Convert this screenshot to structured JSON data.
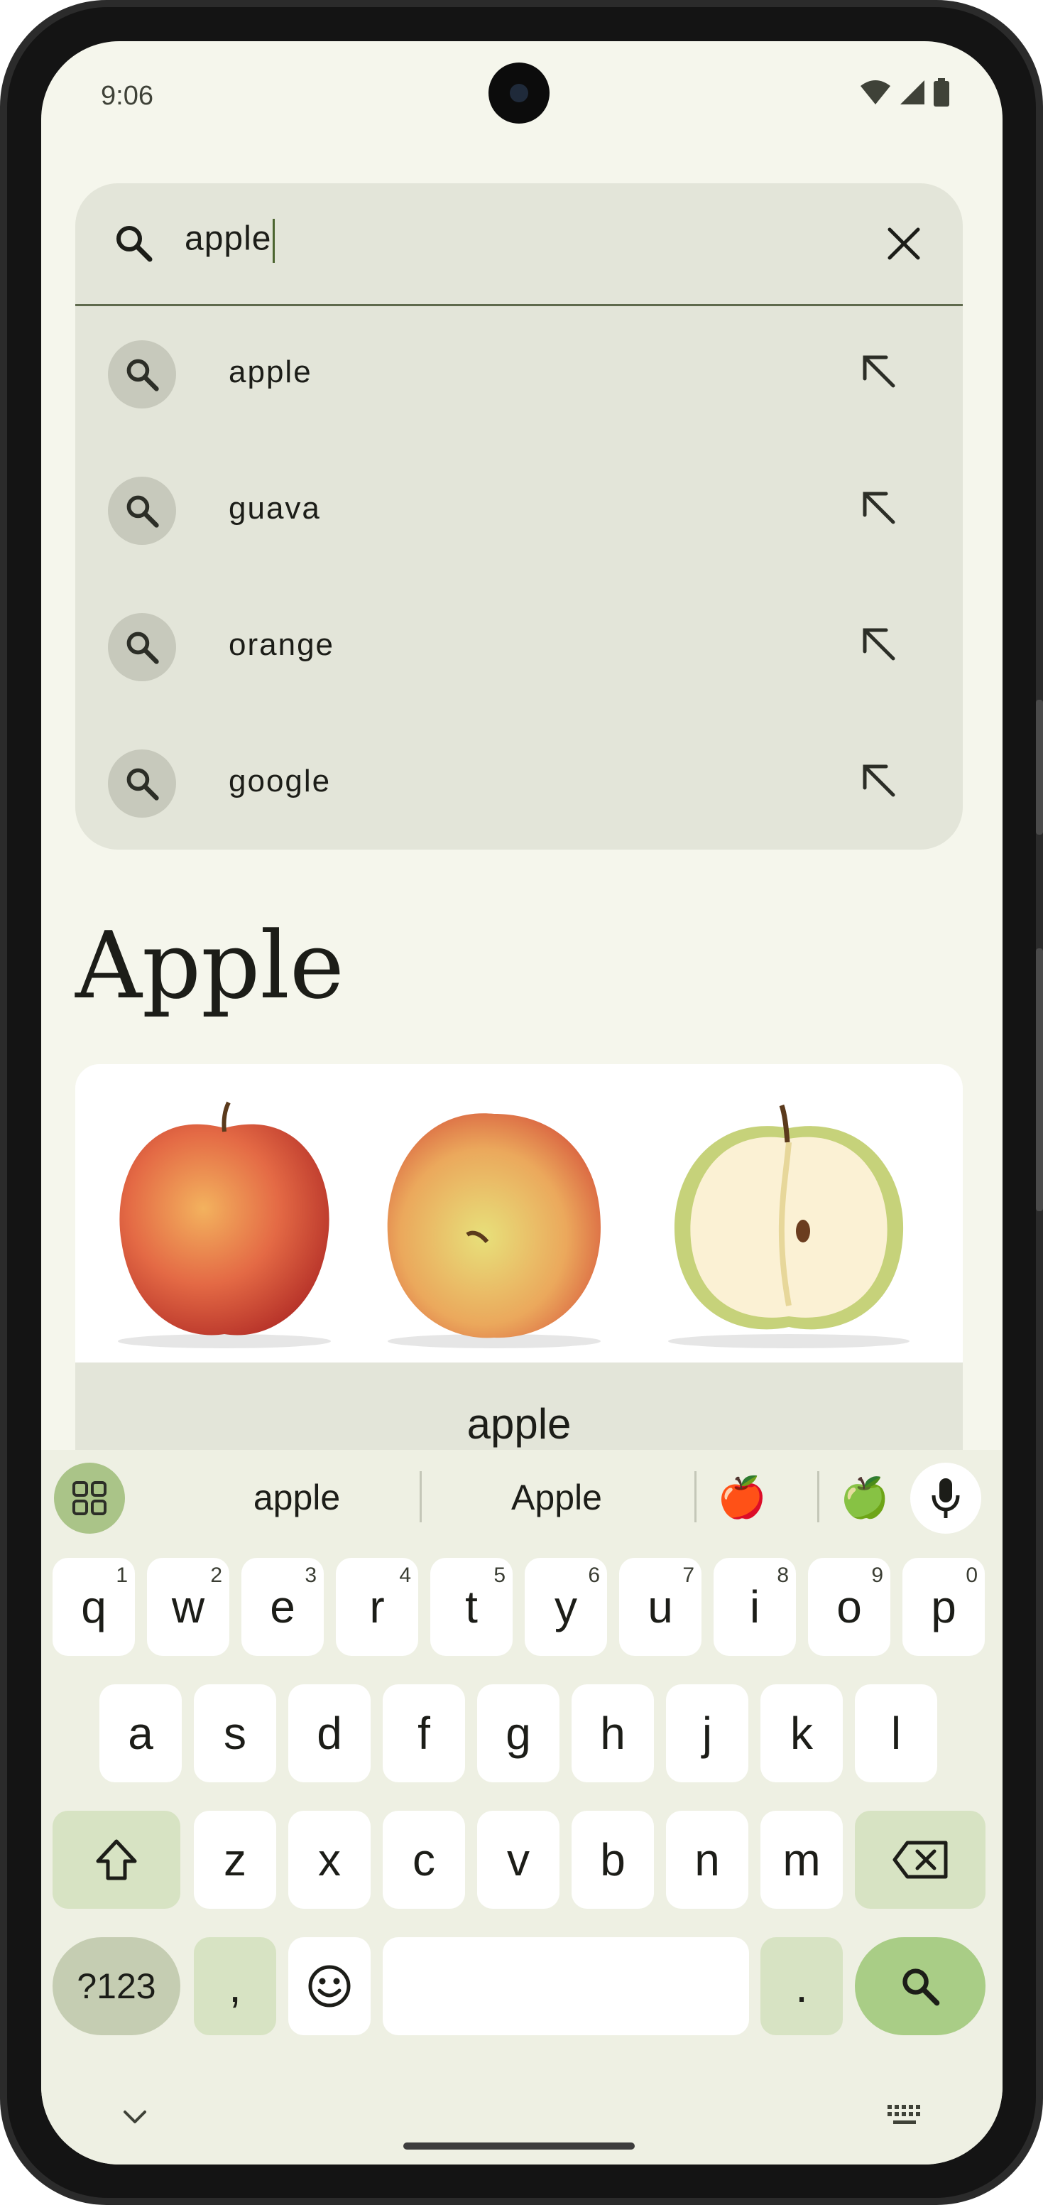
{
  "status": {
    "time": "9:06"
  },
  "search": {
    "query": "apple"
  },
  "suggestions": [
    {
      "label": "apple"
    },
    {
      "label": "guava"
    },
    {
      "label": "orange"
    },
    {
      "label": "google"
    }
  ],
  "result": {
    "title": "Apple",
    "caption": "apple"
  },
  "keyboard": {
    "suggestions": [
      "apple",
      "Apple"
    ],
    "emoji": [
      "🍎",
      "🍏"
    ],
    "row1": [
      {
        "key": "q",
        "hint": "1"
      },
      {
        "key": "w",
        "hint": "2"
      },
      {
        "key": "e",
        "hint": "3"
      },
      {
        "key": "r",
        "hint": "4"
      },
      {
        "key": "t",
        "hint": "5"
      },
      {
        "key": "y",
        "hint": "6"
      },
      {
        "key": "u",
        "hint": "7"
      },
      {
        "key": "i",
        "hint": "8"
      },
      {
        "key": "o",
        "hint": "9"
      },
      {
        "key": "p",
        "hint": "0"
      }
    ],
    "row2": [
      "a",
      "s",
      "d",
      "f",
      "g",
      "h",
      "j",
      "k",
      "l"
    ],
    "row3": [
      "z",
      "x",
      "c",
      "v",
      "b",
      "n",
      "m"
    ],
    "symbols_label": "?123",
    "comma": ",",
    "period": "."
  },
  "colors": {
    "screen_bg": "#f5f6ec",
    "panel_bg": "#e3e5d9",
    "accent": "#a9cd86",
    "caret": "#4c6530"
  }
}
